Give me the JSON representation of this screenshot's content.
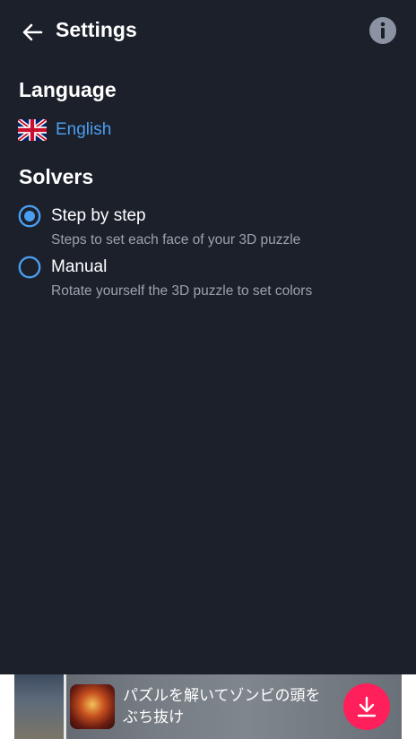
{
  "header": {
    "title": "Settings",
    "back_icon": "arrow-left-icon",
    "info_icon": "info-icon"
  },
  "language": {
    "section_title": "Language",
    "flag_icon": "uk-flag-icon",
    "value": "English"
  },
  "solvers": {
    "section_title": "Solvers",
    "options": [
      {
        "label": "Step by step",
        "description": "Steps to set each face of your 3D puzzle",
        "selected": true
      },
      {
        "label": "Manual",
        "description": "Rotate yourself the 3D puzzle to set colors",
        "selected": false
      }
    ]
  },
  "ad": {
    "text": "パズルを解いてゾンビの頭をぶち抜け",
    "download_icon": "download-icon"
  },
  "colors": {
    "background": "#1b202b",
    "accent": "#4a9ef0",
    "secondary_text": "#9ca3ad",
    "ad_button": "#ff1f5a"
  }
}
